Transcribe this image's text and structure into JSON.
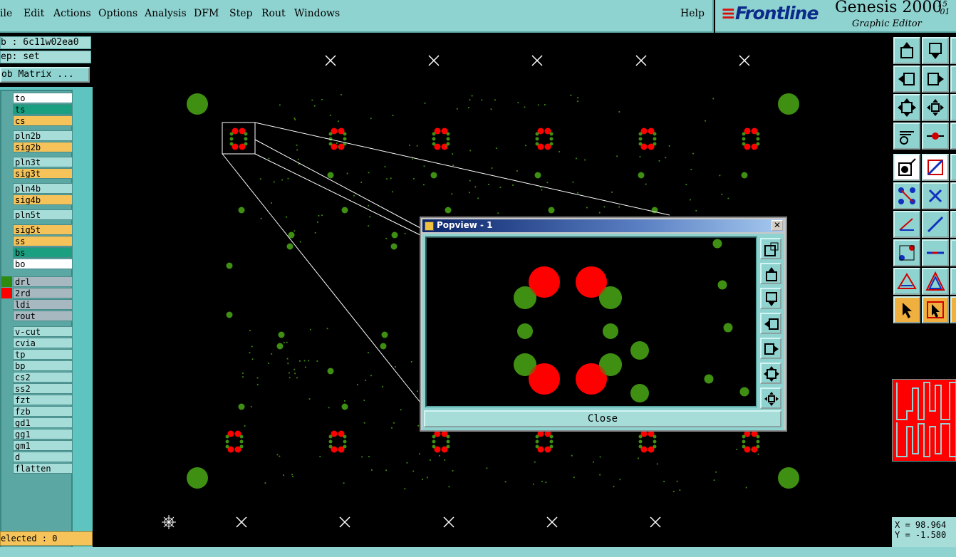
{
  "menu": {
    "items": [
      "ile",
      "Edit",
      "Actions",
      "Options",
      "Analysis",
      "DFM",
      "Step",
      "Rout",
      "Windows",
      "Help"
    ]
  },
  "brand": {
    "logo_text": "Frontline",
    "product": "Genesis 2000",
    "subtitle": "Graphic Editor",
    "version_top": "15",
    "version_bottom": "01"
  },
  "info": {
    "job": "b : 6c11w02ea0",
    "step": "ep: set",
    "job_matrix": "ob Matrix ..."
  },
  "layers": [
    {
      "name": "to",
      "color": "#ffffff"
    },
    {
      "name": "ts",
      "color": "#1aa080"
    },
    {
      "name": "cs",
      "color": "#f5c35a"
    },
    {
      "name": "pln2b",
      "color": "#a6ddd9"
    },
    {
      "name": "sig2b",
      "color": "#f5c35a"
    },
    {
      "name": "pln3t",
      "color": "#a6ddd9"
    },
    {
      "name": "sig3t",
      "color": "#f5c35a"
    },
    {
      "name": "pln4b",
      "color": "#a6ddd9"
    },
    {
      "name": "sig4b",
      "color": "#f5c35a"
    },
    {
      "name": "pln5t",
      "color": "#a6ddd9"
    },
    {
      "name": "sig5t",
      "color": "#f5c35a"
    },
    {
      "name": "ss",
      "color": "#f5c35a"
    },
    {
      "name": "bs",
      "color": "#1aa080"
    },
    {
      "name": "bo",
      "color": "#ffffff"
    },
    {
      "name": "drl",
      "color": "#a8b8c0",
      "swatch": "#2e8b10"
    },
    {
      "name": "2rd",
      "color": "#a8b8c0",
      "swatch": "#ff0000"
    },
    {
      "name": "ldi",
      "color": "#a8b8c0"
    },
    {
      "name": "rout",
      "color": "#a8b8c0"
    },
    {
      "name": "v-cut",
      "color": "#a6ddd9"
    },
    {
      "name": "cvia",
      "color": "#a6ddd9"
    },
    {
      "name": "tp",
      "color": "#a6ddd9"
    },
    {
      "name": "bp",
      "color": "#a6ddd9"
    },
    {
      "name": "cs2",
      "color": "#a6ddd9"
    },
    {
      "name": "ss2",
      "color": "#a6ddd9"
    },
    {
      "name": "fzt",
      "color": "#a6ddd9"
    },
    {
      "name": "fzb",
      "color": "#a6ddd9"
    },
    {
      "name": "gd1",
      "color": "#a6ddd9"
    },
    {
      "name": "gg1",
      "color": "#a6ddd9"
    },
    {
      "name": "gm1",
      "color": "#a6ddd9"
    },
    {
      "name": "d",
      "color": "#a6ddd9"
    },
    {
      "name": "flatten",
      "color": "#a6ddd9"
    }
  ],
  "status": {
    "selected": "elected : 0"
  },
  "popview": {
    "title": "Popview - 1",
    "close_label": "Close"
  },
  "coords": {
    "x": "X = 98.964",
    "y": "Y = -1.580"
  },
  "colors": {
    "panel": "#8fd3d0",
    "drill_green": "#3f8f12",
    "pad_red": "#ff0000",
    "background": "#000000"
  }
}
